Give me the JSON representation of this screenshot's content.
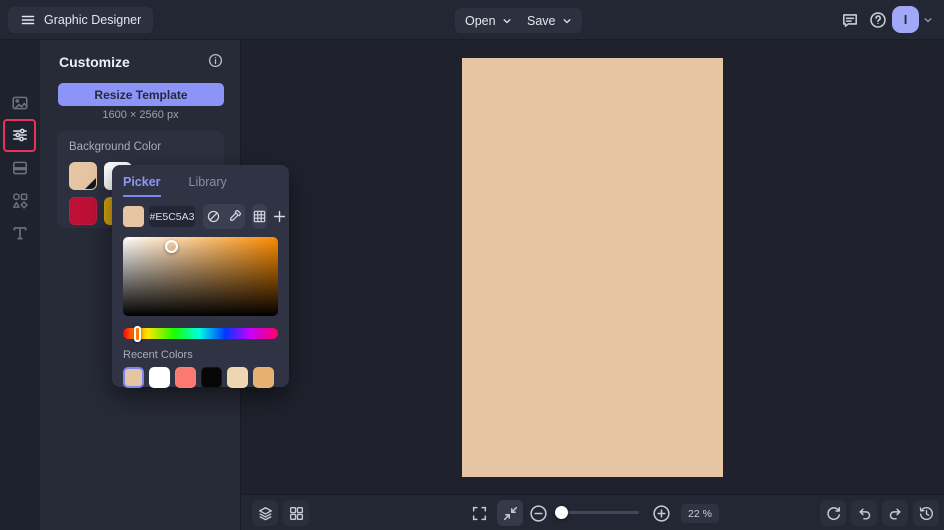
{
  "header": {
    "menu_label": "Graphic Designer",
    "open_label": "Open",
    "save_label": "Save",
    "avatar_initial": "I"
  },
  "panel": {
    "title": "Customize",
    "resize_button_label": "Resize Template",
    "template_size": "1600 × 2560 px",
    "background_color_label": "Background Color",
    "background_swatches": [
      "#E5C5A3",
      "#FFFFFF",
      "#BE1036",
      "#D9A40B"
    ]
  },
  "color_picker": {
    "tabs": [
      {
        "label": "Picker"
      },
      {
        "label": "Library"
      }
    ],
    "active_tab": "Picker",
    "hex": "#E5C5A3",
    "recent_colors_label": "Recent Colors",
    "recent_colors": [
      "#E5C5A3",
      "#FFFFFF",
      "#FA7970",
      "#060606",
      "#EFD6B3",
      "#E6B072"
    ]
  },
  "canvas": {
    "fill": "#E5C5A3"
  },
  "footer": {
    "zoom_value": "22 %"
  },
  "colors": {
    "accent": "#8C94F8",
    "highlight": "#E8305C"
  }
}
